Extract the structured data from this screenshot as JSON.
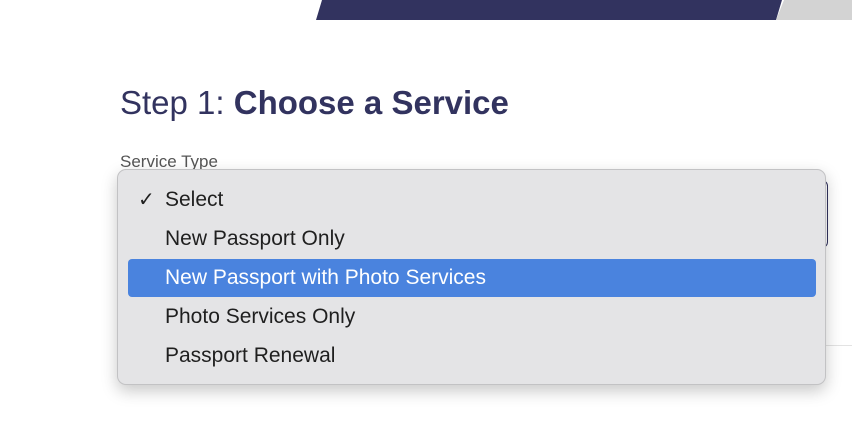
{
  "heading": {
    "prefix": "Step 1: ",
    "title": "Choose a Service"
  },
  "service_type": {
    "label": "Service Type",
    "selected": "Select",
    "options": [
      {
        "label": "Select",
        "checked": true,
        "highlighted": false
      },
      {
        "label": "New Passport Only",
        "checked": false,
        "highlighted": false
      },
      {
        "label": "New Passport with Photo Services",
        "checked": false,
        "highlighted": true
      },
      {
        "label": "Photo Services Only",
        "checked": false,
        "highlighted": false
      },
      {
        "label": "Passport Renewal",
        "checked": false,
        "highlighted": false
      }
    ],
    "check_glyph": "✓"
  },
  "colors": {
    "brand_navy": "#32335f",
    "banner_gray": "#d3d3d3",
    "highlight": "#4a83de",
    "menu_bg": "#e4e4e6"
  }
}
